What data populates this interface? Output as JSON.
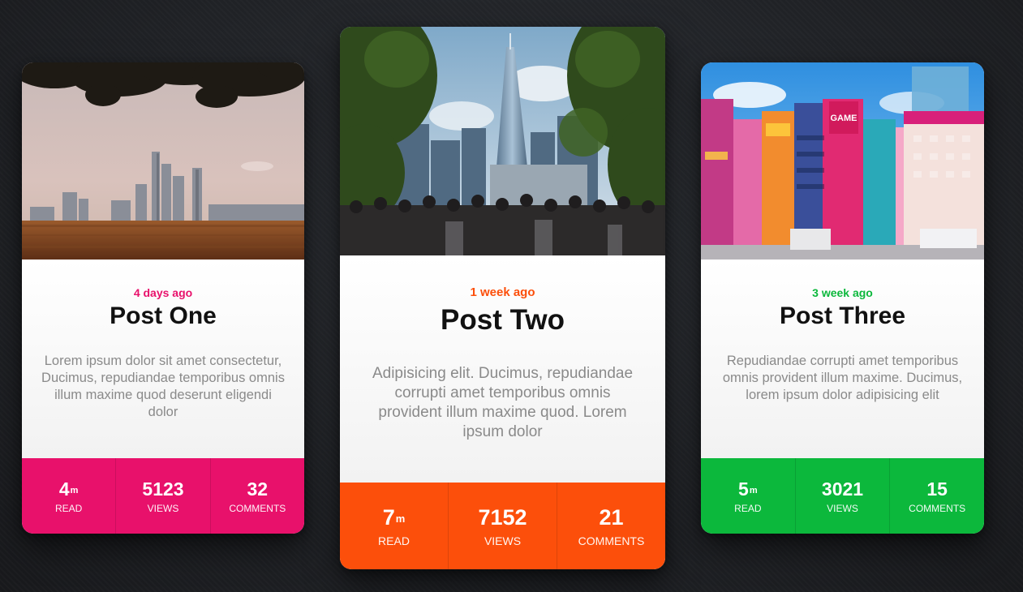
{
  "cards": [
    {
      "date": "4 days ago",
      "title": "Post One",
      "excerpt": "Lorem ipsum dolor sit amet consectetur, Ducimus, repudiandae temporibus omnis illum maxime quod deserunt eligendi dolor",
      "accent": "#e8116b",
      "image": "city-skyline-field-photo",
      "stats": {
        "read_value": "4",
        "read_unit": "m",
        "read_label": "READ",
        "views_value": "5123",
        "views_label": "VIEWS",
        "comments_value": "32",
        "comments_label": "COMMENTS"
      }
    },
    {
      "date": "1 week ago",
      "title": "Post Two",
      "excerpt": "Adipisicing elit. Ducimus, repudiandae corrupti amet temporibus omnis provident illum maxime quod. Lorem ipsum dolor",
      "accent": "#fc4f0b",
      "image": "skyscraper-crowd-trees-photo",
      "stats": {
        "read_value": "7",
        "read_unit": "m",
        "read_label": "READ",
        "views_value": "7152",
        "views_label": "VIEWS",
        "comments_value": "21",
        "comments_label": "COMMENTS"
      }
    },
    {
      "date": "3 week ago",
      "title": "Post Three",
      "excerpt": "Repudiandae corrupti amet temporibus omnis provident illum maxime. Ducimus, lorem ipsum dolor adipisicing elit",
      "accent": "#0cb83c",
      "image": "neon-street-buildings-photo",
      "stats": {
        "read_value": "5",
        "read_unit": "m",
        "read_label": "READ",
        "views_value": "3021",
        "views_label": "VIEWS",
        "comments_value": "15",
        "comments_label": "COMMENTS"
      }
    }
  ],
  "photo_signs": {
    "game_sign": "GAME"
  }
}
